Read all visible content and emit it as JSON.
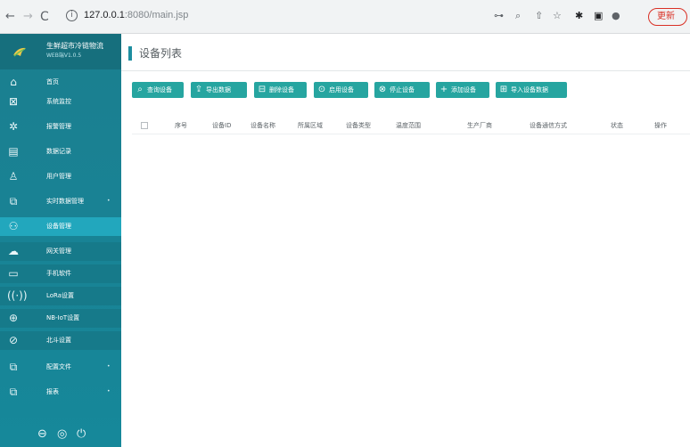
{
  "browser": {
    "url_host": "127.0.0.1",
    "url_rest": ":8080/main.jsp",
    "update_label": "更新"
  },
  "sidebar": {
    "app_name": "生鲜超市冷链物流",
    "app_version": "WEB端V1.0.5",
    "items": [
      {
        "label": "首页",
        "icon": "home-icon"
      },
      {
        "label": "系统监控",
        "icon": "monitor-icon"
      },
      {
        "label": "报警管理",
        "icon": "alarm-icon"
      },
      {
        "label": "数据记录",
        "icon": "record-icon"
      },
      {
        "label": "用户管理",
        "icon": "user-icon"
      },
      {
        "label": "实时数据管理",
        "icon": "data-icon",
        "has_children": true
      },
      {
        "label": "设备管理",
        "icon": "device-icon",
        "active": true
      },
      {
        "label": "网关管理",
        "icon": "cloud-icon"
      },
      {
        "label": "手机软件",
        "icon": "phone-icon"
      },
      {
        "label": "LoRa设置",
        "icon": "lora-icon"
      },
      {
        "label": "NB-IoT设置",
        "icon": "globe-icon"
      },
      {
        "label": "北斗设置",
        "icon": "satellite-icon"
      },
      {
        "label": "配置文件",
        "icon": "config-icon",
        "has_children": true
      },
      {
        "label": "报表",
        "icon": "report-icon",
        "has_children": true
      }
    ],
    "footer": [
      "lock-icon",
      "settings-icon",
      "power-icon"
    ]
  },
  "page": {
    "title": "设备列表"
  },
  "toolbar": {
    "buttons": [
      {
        "label": "查询设备",
        "icon": "search-icon",
        "color": "#26a5a0"
      },
      {
        "label": "导出数据",
        "icon": "export-icon",
        "color": "#26a5a0"
      },
      {
        "label": "删除设备",
        "icon": "delete-icon",
        "color": "#26a5a0"
      },
      {
        "label": "启用设备",
        "icon": "enable-icon",
        "color": "#26a5a0"
      },
      {
        "label": "停止设备",
        "icon": "stop-icon",
        "color": "#26a5a0"
      },
      {
        "label": "添加设备",
        "icon": "plus-icon",
        "color": "#26a5a0"
      },
      {
        "label": "导入设备数据",
        "icon": "import-icon",
        "color": "#26a5a0"
      }
    ]
  },
  "table": {
    "columns": [
      "序号",
      "设备ID",
      "设备名称",
      "所属区域",
      "设备类型",
      "温度范围",
      "生产厂商",
      "设备通信方式",
      "状态",
      "操作"
    ]
  },
  "colors": {
    "sidebar_bg": "#198294",
    "active_item": "#22a7bd",
    "button_bg": "#26a5a0",
    "accent_bar": "#1d8ea0"
  }
}
